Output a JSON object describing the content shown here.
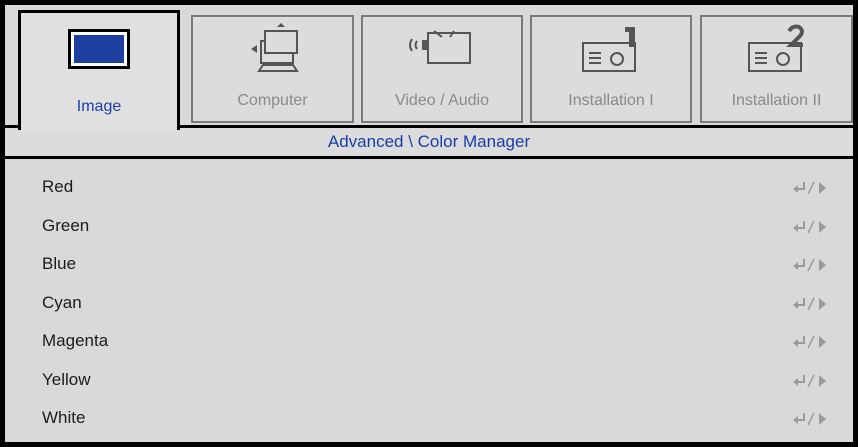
{
  "tabs": [
    {
      "label": "Image",
      "icon": "monitor-icon",
      "active": true
    },
    {
      "label": "Computer",
      "icon": "laptop-icon",
      "active": false
    },
    {
      "label": "Video / Audio",
      "icon": "video-audio-icon",
      "active": false
    },
    {
      "label": "Installation I",
      "icon": "projector-1-icon",
      "active": false
    },
    {
      "label": "Installation II",
      "icon": "projector-2-icon",
      "active": false
    }
  ],
  "subheader": "Advanced \\ Color Manager",
  "items": [
    {
      "label": "Red",
      "action_icon": "enter-arrow-icon"
    },
    {
      "label": "Green",
      "action_icon": "enter-arrow-icon"
    },
    {
      "label": "Blue",
      "action_icon": "enter-arrow-icon"
    },
    {
      "label": "Cyan",
      "action_icon": "enter-arrow-icon"
    },
    {
      "label": "Magenta",
      "action_icon": "enter-arrow-icon"
    },
    {
      "label": "Yellow",
      "action_icon": "enter-arrow-icon"
    },
    {
      "label": "White",
      "action_icon": "enter-arrow-icon"
    }
  ],
  "colors": {
    "accent": "#1a3da8",
    "background": "#d9d9d9",
    "inactive_text": "#8a8a8a",
    "icon_blue": "#1c3fa0"
  }
}
